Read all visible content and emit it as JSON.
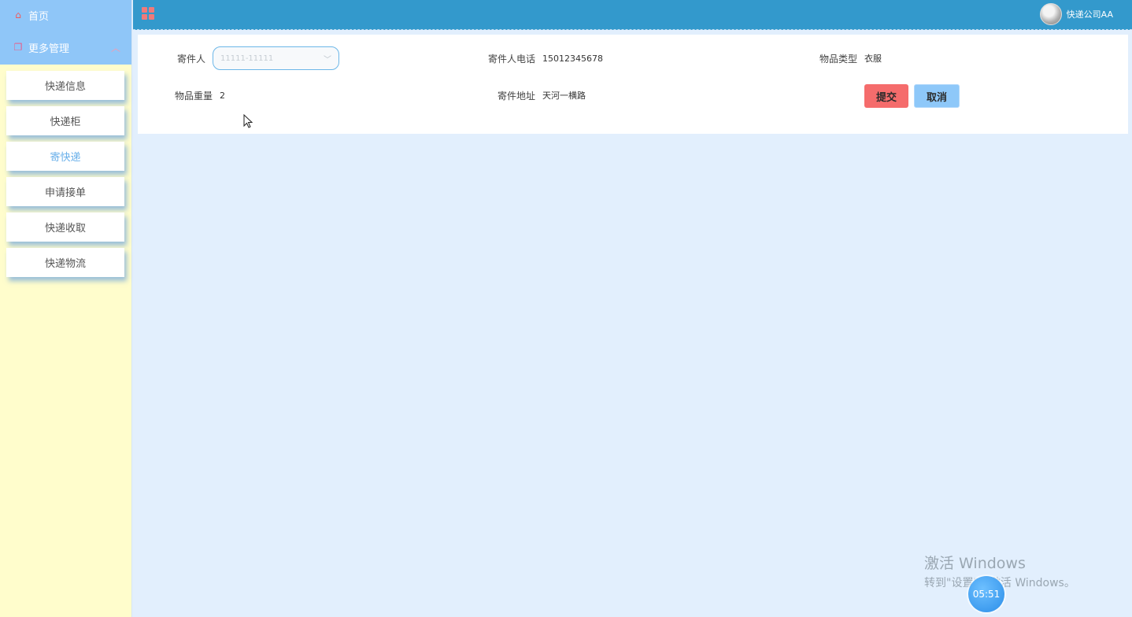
{
  "sidebar": {
    "home_label": "首页",
    "more_label": "更多管理",
    "items": [
      {
        "label": "快递信息"
      },
      {
        "label": "快递柜"
      },
      {
        "label": "寄快递",
        "active": true
      },
      {
        "label": "申请接单"
      },
      {
        "label": "快递收取"
      },
      {
        "label": "快递物流"
      }
    ]
  },
  "header": {
    "user_name": "快递公司AA",
    "accent_color": "#3399cc"
  },
  "form": {
    "sender_label": "寄件人",
    "sender_placeholder": "11111-11111",
    "phone_label": "寄件人电话",
    "phone_value": "15012345678",
    "type_label": "物品类型",
    "type_value": "衣服",
    "weight_label": "物品重量",
    "weight_value": "2",
    "address_label": "寄件地址",
    "address_value": "天河一横路",
    "submit_label": "提交",
    "cancel_label": "取消"
  },
  "watermark": {
    "line1": "激活 Windows",
    "line2": "转到\"设置\"以激活 Windows。",
    "clock": "05:51"
  }
}
